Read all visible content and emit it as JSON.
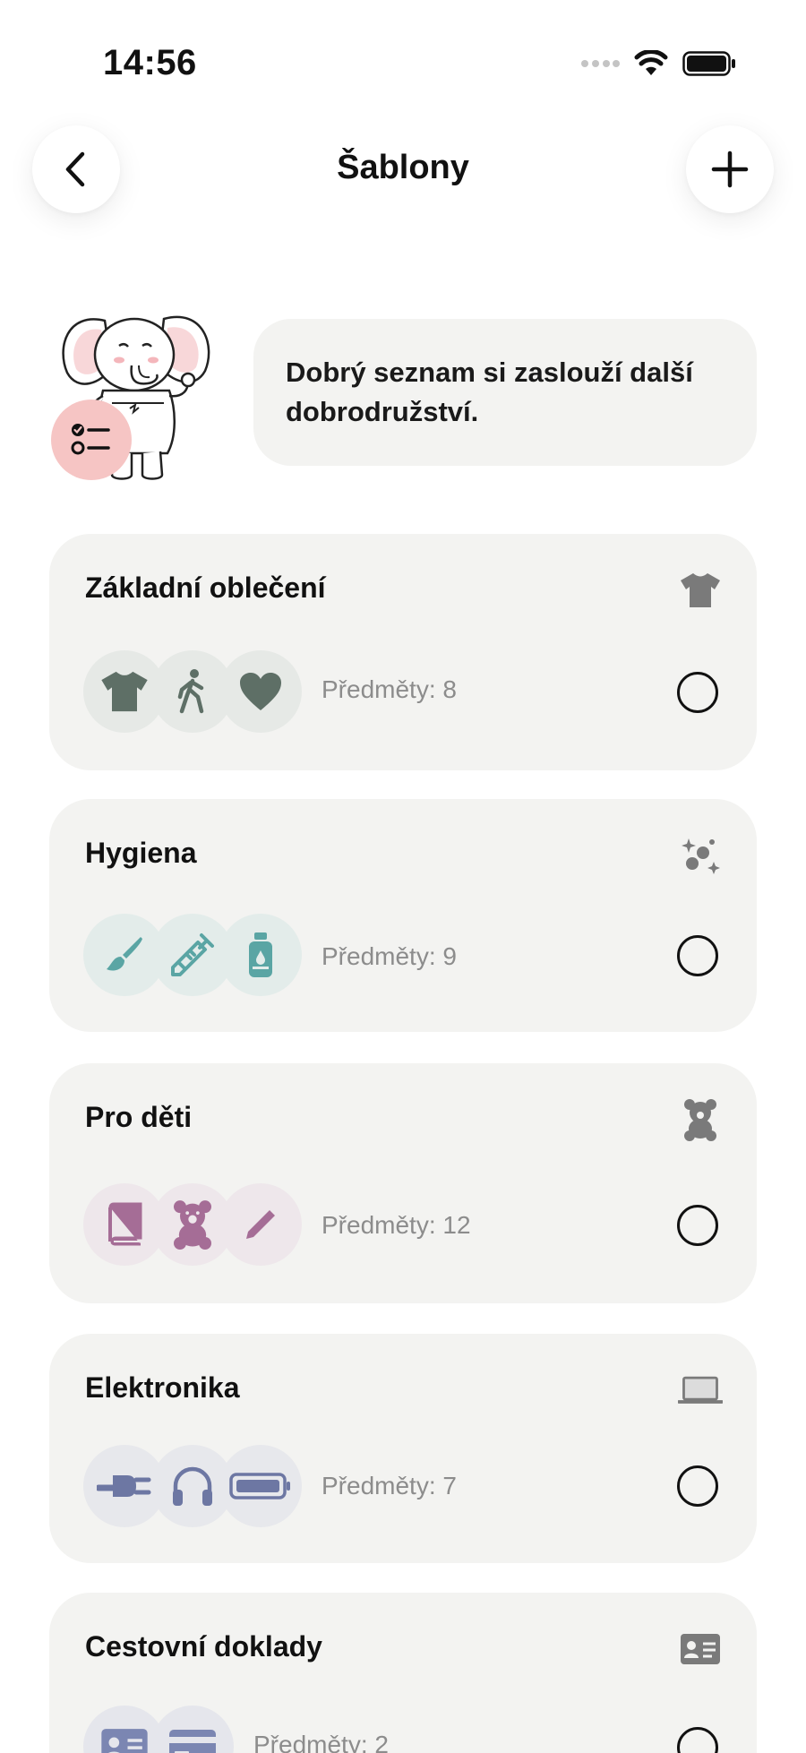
{
  "status_bar": {
    "time": "14:56"
  },
  "nav": {
    "title": "Šablony",
    "back_icon": "chevron-left-icon",
    "add_icon": "plus-icon"
  },
  "hero": {
    "message": "Dobrý seznam si zaslouží další dobrodružství.",
    "mascot": "elephant-illustration",
    "badge_icon": "checklist-icon"
  },
  "templates": [
    {
      "title": "Základní oblečení",
      "icon": "tshirt-icon",
      "count_label": "Předměty: 8",
      "item_icons": [
        "tshirt-icon",
        "walking-icon",
        "heart-icon"
      ],
      "accent": "#5e6f66",
      "bubble_bg": "#e6e9e6"
    },
    {
      "title": "Hygiena",
      "icon": "sparkles-icon",
      "count_label": "Předměty: 9",
      "item_icons": [
        "brush-icon",
        "syringe-icon",
        "bottle-icon"
      ],
      "accent": "#5aa5a4",
      "bubble_bg": "#e3ecea"
    },
    {
      "title": "Pro děti",
      "icon": "teddy-bear-icon",
      "count_label": "Předměty: 12",
      "item_icons": [
        "book-icon",
        "teddy-bear-icon",
        "pencil-icon"
      ],
      "accent": "#a56d96",
      "bubble_bg": "#eee7eb"
    },
    {
      "title": "Elektronika",
      "icon": "laptop-icon",
      "count_label": "Předměty: 7",
      "item_icons": [
        "plug-icon",
        "headphones-icon",
        "battery-icon"
      ],
      "accent": "#6d77a3",
      "bubble_bg": "#e7e8ec"
    },
    {
      "title": "Cestovní doklady",
      "icon": "id-card-icon",
      "count_label": "Předměty: 2",
      "item_icons": [
        "id-card-icon",
        "credit-card-icon"
      ],
      "accent": "#7b86b2",
      "bubble_bg": "#e5e6ec"
    }
  ]
}
